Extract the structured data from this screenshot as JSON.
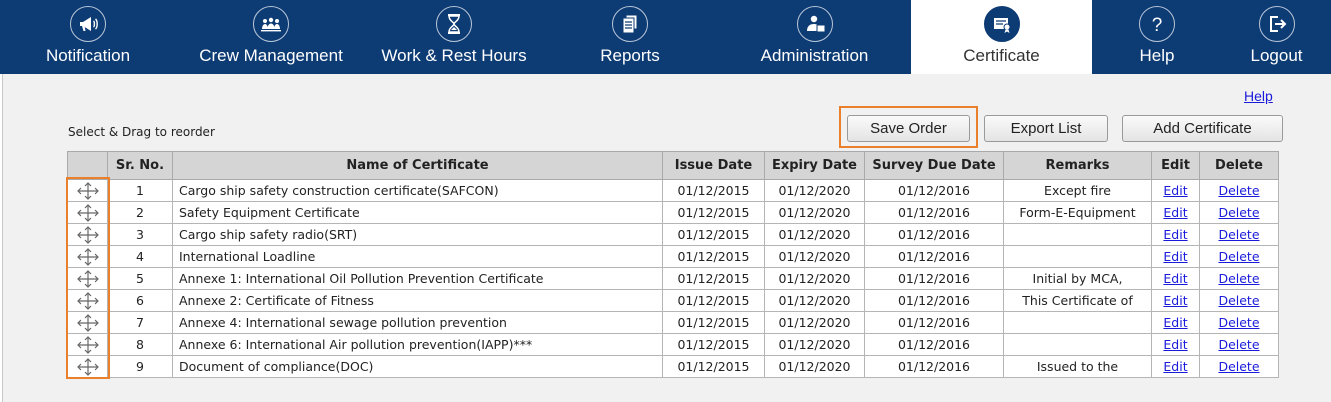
{
  "nav": {
    "items": [
      {
        "label": "Notification",
        "icon": "megaphone-icon"
      },
      {
        "label": "Crew Management",
        "icon": "crew-icon"
      },
      {
        "label": "Work & Rest Hours",
        "icon": "hourglass-icon"
      },
      {
        "label": "Reports",
        "icon": "reports-icon"
      },
      {
        "label": "Administration",
        "icon": "admin-icon"
      },
      {
        "label": "Certificate",
        "icon": "certificate-icon",
        "active": true
      },
      {
        "label": "Help",
        "icon": "help-icon"
      },
      {
        "label": "Logout",
        "icon": "logout-icon"
      }
    ]
  },
  "page": {
    "help_link": "Help",
    "drag_hint": "Select & Drag to reorder",
    "buttons": {
      "save_order": "Save Order",
      "export_list": "Export List",
      "add_certificate": "Add Certificate"
    }
  },
  "table": {
    "headers": [
      "",
      "Sr. No.",
      "Name of Certificate",
      "Issue Date",
      "Expiry Date",
      "Survey Due Date",
      "Remarks",
      "Edit",
      "Delete"
    ],
    "rows": [
      {
        "sr": "1",
        "name": "Cargo ship safety construction certificate(SAFCON)",
        "issue": "01/12/2015",
        "expiry": "01/12/2020",
        "survey": "01/12/2016",
        "remarks": "Except fire",
        "edit": "Edit",
        "delete": "Delete"
      },
      {
        "sr": "2",
        "name": "Safety Equipment Certificate",
        "issue": "01/12/2015",
        "expiry": "01/12/2020",
        "survey": "01/12/2016",
        "remarks": "Form-E-Equipment",
        "edit": "Edit",
        "delete": "Delete"
      },
      {
        "sr": "3",
        "name": "Cargo ship safety radio(SRT)",
        "issue": "01/12/2015",
        "expiry": "01/12/2020",
        "survey": "01/12/2016",
        "remarks": "",
        "edit": "Edit",
        "delete": "Delete"
      },
      {
        "sr": "4",
        "name": "International Loadline",
        "issue": "01/12/2015",
        "expiry": "01/12/2020",
        "survey": "01/12/2016",
        "remarks": "",
        "edit": "Edit",
        "delete": "Delete"
      },
      {
        "sr": "5",
        "name": "Annexe 1: International Oil Pollution Prevention Certificate",
        "issue": "01/12/2015",
        "expiry": "01/12/2020",
        "survey": "01/12/2016",
        "remarks": "Initial by MCA,",
        "edit": "Edit",
        "delete": "Delete"
      },
      {
        "sr": "6",
        "name": "Annexe 2: Certificate of Fitness",
        "issue": "01/12/2015",
        "expiry": "01/12/2020",
        "survey": "01/12/2016",
        "remarks": "This Certificate of",
        "edit": "Edit",
        "delete": "Delete"
      },
      {
        "sr": "7",
        "name": "Annexe 4: International sewage pollution prevention",
        "issue": "01/12/2015",
        "expiry": "01/12/2020",
        "survey": "01/12/2016",
        "remarks": "",
        "edit": "Edit",
        "delete": "Delete"
      },
      {
        "sr": "8",
        "name": "Annexe 6: International Air pollution prevention(IAPP)***",
        "issue": "01/12/2015",
        "expiry": "01/12/2020",
        "survey": "01/12/2016",
        "remarks": "",
        "edit": "Edit",
        "delete": "Delete"
      },
      {
        "sr": "9",
        "name": "Document of compliance(DOC)",
        "issue": "01/12/2015",
        "expiry": "01/12/2020",
        "survey": "01/12/2016",
        "remarks": "Issued to the",
        "edit": "Edit",
        "delete": "Delete"
      }
    ]
  },
  "colors": {
    "nav_bg": "#0d3b74",
    "highlight": "#ea7f2c",
    "link": "#1a1adb"
  }
}
